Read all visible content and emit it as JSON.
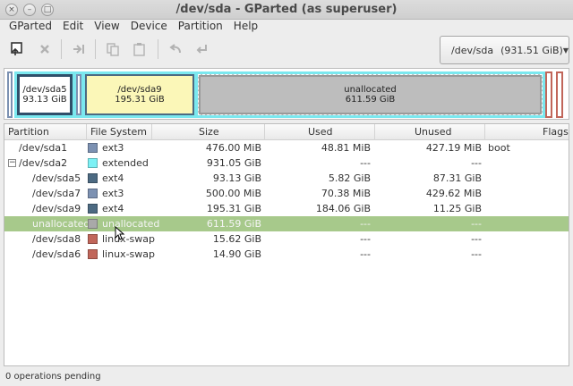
{
  "window": {
    "title": "/dev/sda - GParted (as superuser)"
  },
  "menubar": [
    "GParted",
    "Edit",
    "View",
    "Device",
    "Partition",
    "Help"
  ],
  "toolbar": {
    "icons": [
      "new-partition-icon",
      "delete-icon",
      "resize-move-icon",
      "copy-icon",
      "paste-icon",
      "undo-icon",
      "apply-icon"
    ],
    "device": {
      "name": "/dev/sda",
      "size": "(931.51 GiB)"
    }
  },
  "diskmap": {
    "sda5": {
      "name": "/dev/sda5",
      "size": "93.13 GiB",
      "color": "#4c6a82"
    },
    "sda9": {
      "name": "/dev/sda9",
      "size": "195.31 GiB",
      "color": "#4c6a82"
    },
    "unallocated": {
      "name": "unallocated",
      "size": "611.59 GiB"
    },
    "extended_color": "#7be8ef",
    "swap_color": "#c1665a"
  },
  "table": {
    "headers": [
      "Partition",
      "File System",
      "Size",
      "Used",
      "Unused",
      "Flags"
    ],
    "rows": [
      {
        "partition": "/dev/sda1",
        "fs": "ext3",
        "fs_color": "#7c91b2",
        "size": "476.00 MiB",
        "used": "48.81 MiB",
        "unused": "427.19 MiB",
        "flags": "boot"
      },
      {
        "partition": "/dev/sda2",
        "fs": "extended",
        "fs_color": "#7cf1f5",
        "size": "931.05 GiB",
        "used": "---",
        "unused": "---",
        "flags": ""
      },
      {
        "partition": "/dev/sda5",
        "fs": "ext4",
        "fs_color": "#4c6a82",
        "size": "93.13 GiB",
        "used": "5.82 GiB",
        "unused": "87.31 GiB",
        "flags": ""
      },
      {
        "partition": "/dev/sda7",
        "fs": "ext3",
        "fs_color": "#7c91b2",
        "size": "500.00 MiB",
        "used": "70.38 MiB",
        "unused": "429.62 MiB",
        "flags": ""
      },
      {
        "partition": "/dev/sda9",
        "fs": "ext4",
        "fs_color": "#4c6a82",
        "size": "195.31 GiB",
        "used": "184.06 GiB",
        "unused": "11.25 GiB",
        "flags": ""
      },
      {
        "partition": "unallocated",
        "fs": "unallocated",
        "fs_color": "#a9a9a9",
        "size": "611.59 GiB",
        "used": "---",
        "unused": "---",
        "flags": ""
      },
      {
        "partition": "/dev/sda8",
        "fs": "linux-swap",
        "fs_color": "#c1665a",
        "size": "15.62 GiB",
        "used": "---",
        "unused": "---",
        "flags": ""
      },
      {
        "partition": "/dev/sda6",
        "fs": "linux-swap",
        "fs_color": "#c1665a",
        "size": "14.90 GiB",
        "used": "---",
        "unused": "---",
        "flags": ""
      }
    ]
  },
  "status": "0 operations pending"
}
